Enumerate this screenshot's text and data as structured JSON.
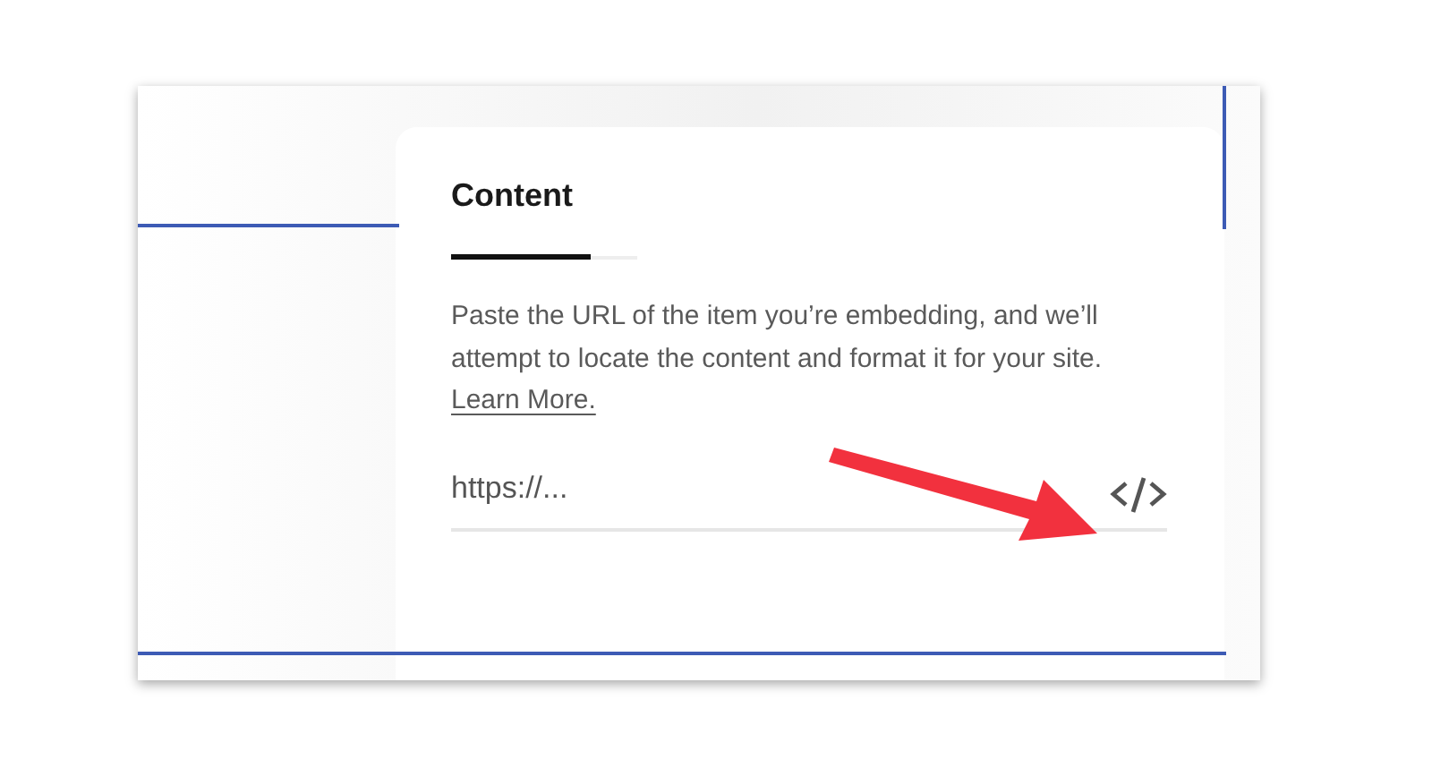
{
  "panel": {
    "tabs": [
      {
        "label": "Content",
        "selected": true
      }
    ],
    "description": "Paste the URL of the item you’re embedding, and we’ll attempt to locate the content and format it for your site. ",
    "link": "Learn More.",
    "url_field": {
      "placeholder": "https://..."
    }
  }
}
